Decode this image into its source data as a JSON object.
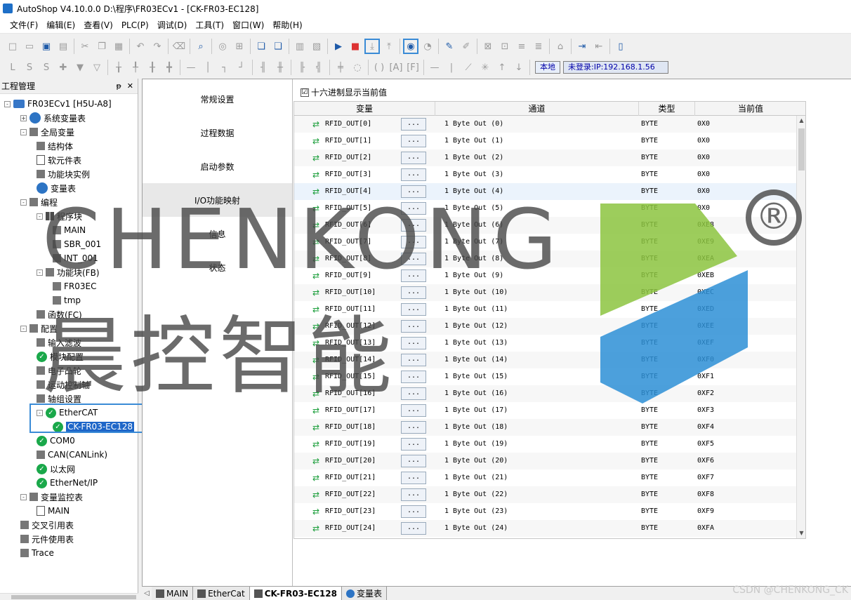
{
  "window": {
    "title": "AutoShop V4.10.0.0  D:\\程序\\FR03ECv1 - [CK-FR03-EC128]"
  },
  "menu": [
    "文件(F)",
    "编辑(E)",
    "查看(V)",
    "PLC(P)",
    "调试(D)",
    "工具(T)",
    "窗口(W)",
    "帮助(H)"
  ],
  "status": {
    "local": "本地",
    "login": "未登录:IP:192.168.1.56"
  },
  "project": {
    "title": "工程管理",
    "pin": "ᵽ",
    "close": "✕",
    "tree": [
      {
        "label": "FR03ECv1 [H5U-A8]",
        "icon": "pc-icon",
        "exp": "-"
      },
      {
        "label": "系统变量表",
        "icon": "globe-icon",
        "exp": "+"
      },
      {
        "label": "全局变量",
        "icon": "table-icon",
        "exp": "-"
      },
      {
        "label": "结构体",
        "icon": "struct-icon",
        "exp": ""
      },
      {
        "label": "软元件表",
        "icon": "doc-icon",
        "exp": ""
      },
      {
        "label": "功能块实例",
        "icon": "cube-icon",
        "exp": ""
      },
      {
        "label": "变量表",
        "icon": "globe-icon",
        "exp": ""
      },
      {
        "label": "编程",
        "icon": "ladder-icon",
        "exp": "-"
      },
      {
        "label": "程序块",
        "icon": "grid-icon",
        "exp": "-"
      },
      {
        "label": "MAIN",
        "icon": "ladder-doc-icon",
        "exp": ""
      },
      {
        "label": "SBR_001",
        "icon": "sbr-icon",
        "exp": ""
      },
      {
        "label": "INT_001",
        "icon": "int-icon",
        "exp": ""
      },
      {
        "label": "功能块(FB)",
        "icon": "fb-folder-icon",
        "exp": "-"
      },
      {
        "label": "FR03EC",
        "icon": "fb-icon",
        "exp": ""
      },
      {
        "label": "tmp",
        "icon": "fb-icon",
        "exp": ""
      },
      {
        "label": "函数(FC)",
        "icon": "fc-icon",
        "exp": ""
      },
      {
        "label": "配置",
        "icon": "config-icon",
        "exp": "-"
      },
      {
        "label": "输入滤波",
        "icon": "filter-icon",
        "exp": ""
      },
      {
        "label": "模块配置",
        "icon": "ok-icon",
        "exp": ""
      },
      {
        "label": "电子凸轮",
        "icon": "cam-icon",
        "exp": ""
      },
      {
        "label": "运动控制轴",
        "icon": "axis-icon",
        "exp": ""
      },
      {
        "label": "轴组设置",
        "icon": "gear-icon",
        "exp": ""
      },
      {
        "label": "EtherCAT",
        "icon": "ok-icon",
        "exp": "-"
      },
      {
        "label": "CK-FR03-EC128",
        "icon": "ok-icon",
        "exp": ""
      },
      {
        "label": "COM0",
        "icon": "ok-icon",
        "exp": ""
      },
      {
        "label": "CAN(CANLink)",
        "icon": "network-icon",
        "exp": ""
      },
      {
        "label": "以太网",
        "icon": "ok-icon",
        "exp": ""
      },
      {
        "label": "EtherNet/IP",
        "icon": "ok-icon",
        "exp": ""
      },
      {
        "label": "变量监控表",
        "icon": "monitor-icon",
        "exp": "-"
      },
      {
        "label": "MAIN",
        "icon": "doc-icon",
        "exp": ""
      },
      {
        "label": "交叉引用表",
        "icon": "crossref-icon",
        "exp": ""
      },
      {
        "label": "元件使用表",
        "icon": "db-icon",
        "exp": ""
      },
      {
        "label": "Trace",
        "icon": "trace-icon",
        "exp": ""
      }
    ]
  },
  "nav": [
    "常规设置",
    "过程数据",
    "启动参数",
    "I/O功能映射",
    "信息",
    "状态"
  ],
  "hexToggle": {
    "label": "十六进制显示当前值",
    "checked": "☑"
  },
  "grid": {
    "headers": [
      "变量",
      "通道",
      "类型",
      "当前值"
    ],
    "dots": "...",
    "rows": [
      {
        "var": "RFID_OUT[0]",
        "ch": "1 Byte Out (0)",
        "type": "BYTE",
        "val": "0X0"
      },
      {
        "var": "RFID_OUT[1]",
        "ch": "1 Byte Out (1)",
        "type": "BYTE",
        "val": "0X0"
      },
      {
        "var": "RFID_OUT[2]",
        "ch": "1 Byte Out (2)",
        "type": "BYTE",
        "val": "0X0"
      },
      {
        "var": "RFID_OUT[3]",
        "ch": "1 Byte Out (3)",
        "type": "BYTE",
        "val": "0X0"
      },
      {
        "var": "RFID_OUT[4]",
        "ch": "1 Byte Out (4)",
        "type": "BYTE",
        "val": "0X0"
      },
      {
        "var": "RFID_OUT[5]",
        "ch": "1 Byte Out (5)",
        "type": "BYTE",
        "val": "0X0"
      },
      {
        "var": "RFID_OUT[6]",
        "ch": "1 Byte Out (6)",
        "type": "BYTE",
        "val": "0XE8"
      },
      {
        "var": "RFID_OUT[7]",
        "ch": "1 Byte Out (7)",
        "type": "BYTE",
        "val": "0XE9"
      },
      {
        "var": "RFID_OUT[8]",
        "ch": "1 Byte Out (8)",
        "type": "BYTE",
        "val": "0XEA"
      },
      {
        "var": "RFID_OUT[9]",
        "ch": "1 Byte Out (9)",
        "type": "BYTE",
        "val": "0XEB"
      },
      {
        "var": "RFID_OUT[10]",
        "ch": "1 Byte Out (10)",
        "type": "BYTE",
        "val": "0XEC"
      },
      {
        "var": "RFID_OUT[11]",
        "ch": "1 Byte Out (11)",
        "type": "BYTE",
        "val": "0XED"
      },
      {
        "var": "RFID_OUT[12]",
        "ch": "1 Byte Out (12)",
        "type": "BYTE",
        "val": "0XEE"
      },
      {
        "var": "RFID_OUT[13]",
        "ch": "1 Byte Out (13)",
        "type": "BYTE",
        "val": "0XEF"
      },
      {
        "var": "RFID_OUT[14]",
        "ch": "1 Byte Out (14)",
        "type": "BYTE",
        "val": "0XF0"
      },
      {
        "var": "RFID_OUT[15]",
        "ch": "1 Byte Out (15)",
        "type": "BYTE",
        "val": "0XF1"
      },
      {
        "var": "RFID_OUT[16]",
        "ch": "1 Byte Out (16)",
        "type": "BYTE",
        "val": "0XF2"
      },
      {
        "var": "RFID_OUT[17]",
        "ch": "1 Byte Out (17)",
        "type": "BYTE",
        "val": "0XF3"
      },
      {
        "var": "RFID_OUT[18]",
        "ch": "1 Byte Out (18)",
        "type": "BYTE",
        "val": "0XF4"
      },
      {
        "var": "RFID_OUT[19]",
        "ch": "1 Byte Out (19)",
        "type": "BYTE",
        "val": "0XF5"
      },
      {
        "var": "RFID_OUT[20]",
        "ch": "1 Byte Out (20)",
        "type": "BYTE",
        "val": "0XF6"
      },
      {
        "var": "RFID_OUT[21]",
        "ch": "1 Byte Out (21)",
        "type": "BYTE",
        "val": "0XF7"
      },
      {
        "var": "RFID_OUT[22]",
        "ch": "1 Byte Out (22)",
        "type": "BYTE",
        "val": "0XF8"
      },
      {
        "var": "RFID_OUT[23]",
        "ch": "1 Byte Out (23)",
        "type": "BYTE",
        "val": "0XF9"
      },
      {
        "var": "RFID_OUT[24]",
        "ch": "1 Byte Out (24)",
        "type": "BYTE",
        "val": "0XFA"
      }
    ]
  },
  "tabs": [
    {
      "label": "MAIN",
      "active": false
    },
    {
      "label": "EtherCat",
      "active": false
    },
    {
      "label": "CK-FR03-EC128",
      "active": true
    },
    {
      "label": "变量表",
      "active": false
    }
  ],
  "watermark": {
    "brand": "CHENKONG",
    "cn": "晨控智能",
    "reg": "®",
    "csdn": "CSDN @CHENKONG_CK"
  },
  "colors": {
    "accent": "#3a8bd6",
    "ok": "#1aa84a",
    "selection": "#1e66c8",
    "logoGreen": "#8cc43f",
    "logoBlue": "#2d8fd6"
  }
}
